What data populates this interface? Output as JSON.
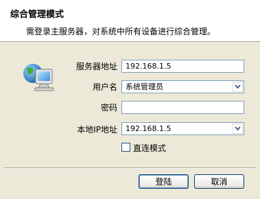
{
  "header": {
    "title": "综合管理模式",
    "description": "需登录主服务器，对系统中所有设备进行综合管理。"
  },
  "form": {
    "server_address": {
      "label": "服务器地址",
      "value": "192.168.1.5"
    },
    "username": {
      "label": "用户名",
      "value": "系统管理员"
    },
    "password": {
      "label": "密码",
      "value": ""
    },
    "local_ip": {
      "label": "本地IP地址",
      "value": "192.168.1.5"
    },
    "direct_mode": {
      "label": "直连模式",
      "checked": false
    }
  },
  "buttons": {
    "login": "登陆",
    "cancel": "取消"
  },
  "icons": {
    "illustration": "network-computer-icon"
  },
  "colors": {
    "window_bg": "#ECE9D8",
    "header_bg": "#FFFFFF",
    "field_border": "#7F9DB9",
    "button_border": "#003C74"
  }
}
